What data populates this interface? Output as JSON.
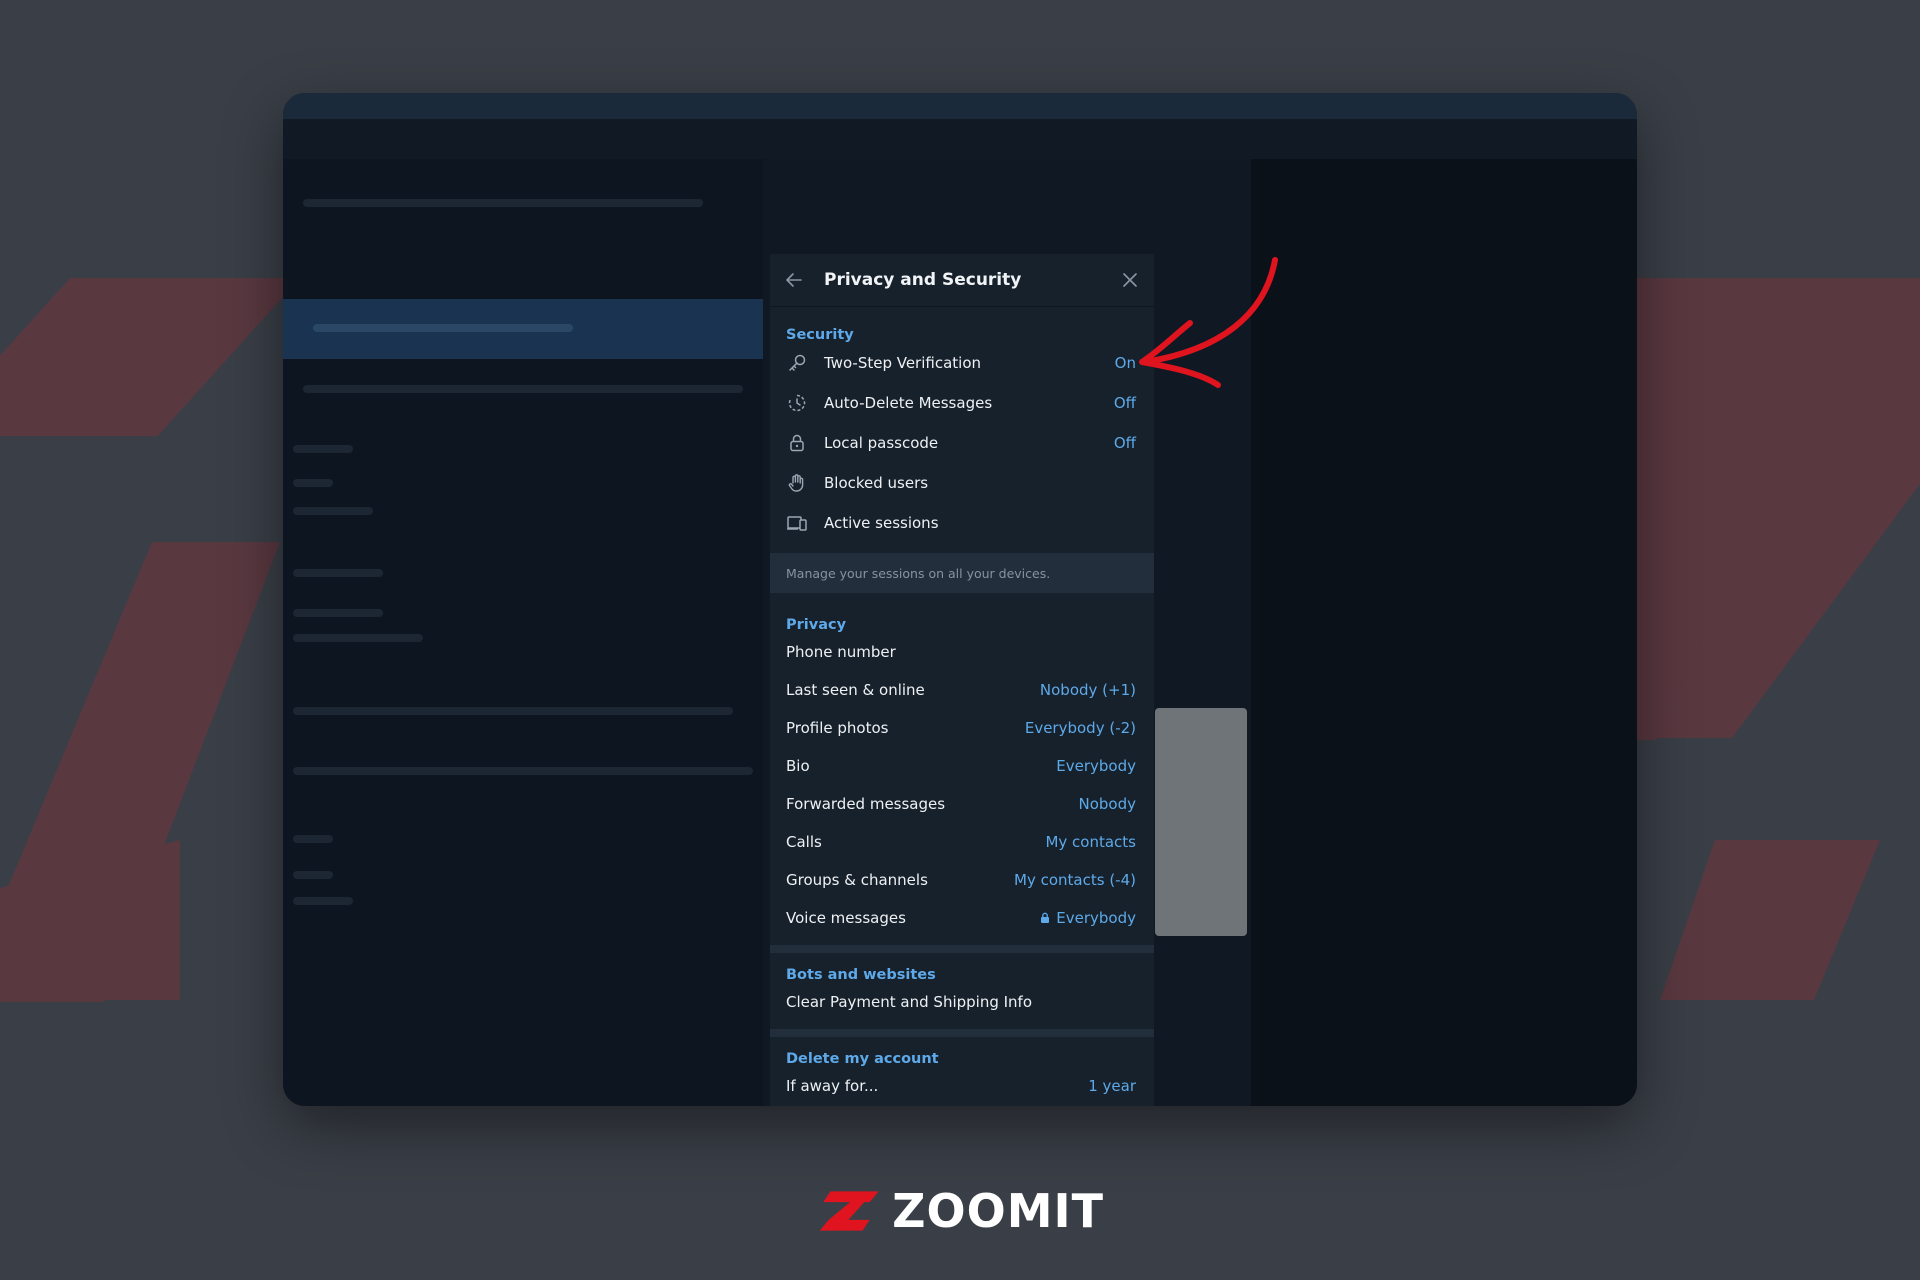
{
  "panel": {
    "title": "Privacy and Security"
  },
  "security": {
    "section_title": "Security",
    "items": [
      {
        "label": "Two-Step Verification",
        "value": "On",
        "icon": "key-icon"
      },
      {
        "label": "Auto-Delete Messages",
        "value": "Off",
        "icon": "timer-icon"
      },
      {
        "label": "Local passcode",
        "value": "Off",
        "icon": "lock-icon"
      },
      {
        "label": "Blocked users",
        "value": "",
        "icon": "hand-icon"
      },
      {
        "label": "Active sessions",
        "value": "",
        "icon": "devices-icon"
      }
    ],
    "note": "Manage your sessions on all your devices."
  },
  "privacy": {
    "section_title": "Privacy",
    "items": [
      {
        "label": "Phone number",
        "value": ""
      },
      {
        "label": "Last seen & online",
        "value": "Nobody (+1)"
      },
      {
        "label": "Profile photos",
        "value": "Everybody (-2)"
      },
      {
        "label": "Bio",
        "value": "Everybody"
      },
      {
        "label": "Forwarded messages",
        "value": "Nobody"
      },
      {
        "label": "Calls",
        "value": "My contacts"
      },
      {
        "label": "Groups & channels",
        "value": "My contacts (-4)"
      },
      {
        "label": "Voice messages",
        "value": "Everybody",
        "locked": true
      }
    ]
  },
  "bots": {
    "section_title": "Bots and websites",
    "items": [
      {
        "label": "Clear Payment and Shipping Info",
        "value": ""
      }
    ]
  },
  "delete_account": {
    "section_title": "Delete my account",
    "items": [
      {
        "label": "If away for...",
        "value": "1 year"
      }
    ]
  },
  "logo": {
    "text": "ZOOMIT"
  },
  "colors": {
    "accent": "#5ea9e9",
    "panel_bg": "#17212b",
    "annotation": "#e0141e",
    "brand_red": "#e0141e"
  }
}
